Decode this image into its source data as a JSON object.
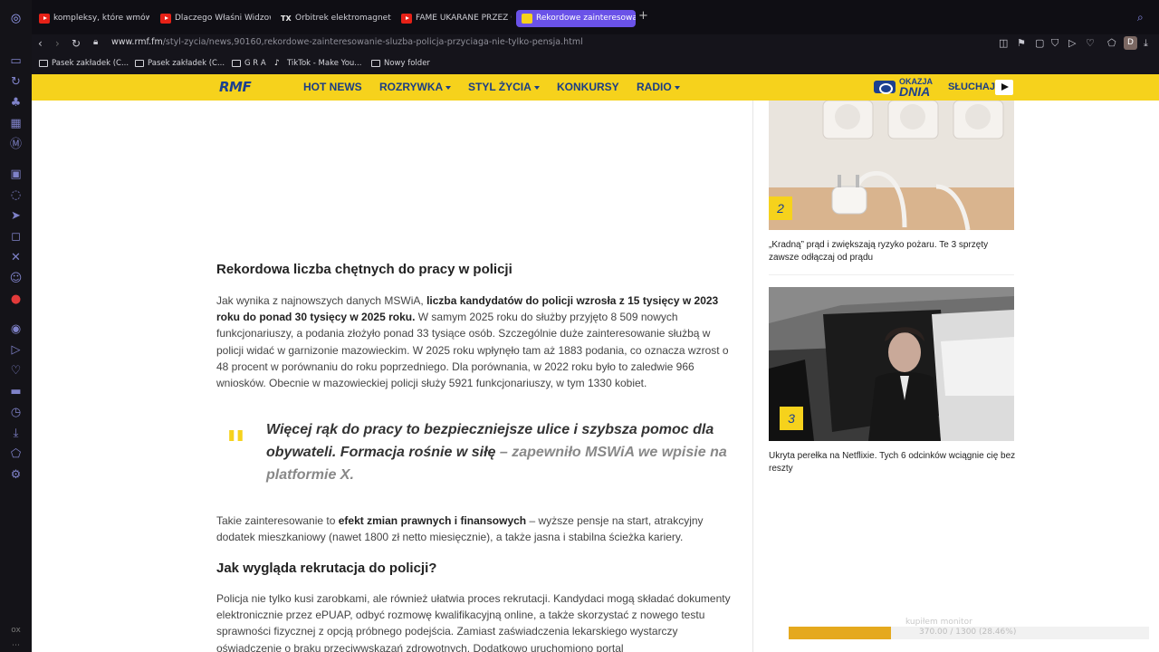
{
  "browser": {
    "tabs": [
      {
        "label": "kompleksy, które wmówiły",
        "favicon": "youtube-icon"
      },
      {
        "label": "Dlaczego Właśni Widzowie",
        "favicon": "youtube-icon"
      },
      {
        "label": "Orbitrek elektromagnetyczny",
        "favicon": "tx-icon"
      },
      {
        "label": "FAME UKARANE PRZEZ O",
        "favicon": "youtube-icon"
      },
      {
        "label": "Rekordowe zainteresowanie",
        "favicon": "rmf-icon",
        "active": true
      }
    ],
    "new_tab": "+",
    "url_host": "www.rmf.fm",
    "url_path": "/styl-zycia/news,90160,rekordowe-zainteresowanie-sluzba-policja-przyciaga-nie-tylko-pensja.html",
    "profile_initial": "D",
    "bookmarks": [
      {
        "label": "Pasek zakładek (C...",
        "icon": "folder-icon"
      },
      {
        "label": "Pasek zakładek (C...",
        "icon": "folder-icon"
      },
      {
        "label": "G R A",
        "icon": "folder-icon"
      },
      {
        "label": "TikTok - Make You...",
        "icon": "tiktok-icon"
      },
      {
        "label": "Nowy folder",
        "icon": "folder-icon"
      }
    ],
    "sidebar_bottom": "ox"
  },
  "site": {
    "logo": "RMF",
    "menu": [
      {
        "label": "HOT NEWS",
        "dropdown": false
      },
      {
        "label": "ROZRYWKA",
        "dropdown": true
      },
      {
        "label": "STYL ŻYCIA",
        "dropdown": true
      },
      {
        "label": "KONKURSY",
        "dropdown": false
      },
      {
        "label": "RADIO",
        "dropdown": true
      }
    ],
    "okazja_top": "OKAZJA",
    "okazja_bottom": "DNIA",
    "listen": "SŁUCHAJ",
    "accent": "#f6d21c",
    "brand_blue": "#1b3f8f"
  },
  "article": {
    "heading1": "Rekordowa liczba chętnych do pracy w policji",
    "p1_a": "Jak wynika z najnowszych danych MSWiA, ",
    "p1_bold": "liczba kandydatów do policji wzrosła z 15 tysięcy w 2023 roku do ponad 30 tysięcy w 2025 roku.",
    "p1_b": " W samym 2025 roku do służby przyjęto 8 509 nowych funkcjonariuszy, a podania złożyło ponad 33 tysiące osób. Szczególnie duże zainteresowanie służbą w policji widać w garnizonie mazowieckim. W 2025 roku wpłynęło tam aż 1883 podania, co oznacza wzrost o 48 procent w porównaniu do roku poprzedniego. Dla porównania, w 2022 roku było to zaledwie 966 wniosków. Obecnie w mazowieckiej policji służy 5921 funkcjonariuszy, w tym 1330 kobiet.",
    "quote_mark": "\"",
    "quote_text": "Więcej rąk do pracy to bezpieczniejsze ulice i szybsza pomoc dla obywateli. Formacja rośnie w siłę",
    "quote_source": " – zapewniło MSWiA we wpisie na platformie X.",
    "p2_a": "Takie zainteresowanie to ",
    "p2_bold": "efekt zmian prawnych i finansowych",
    "p2_b": " – wyższe pensje na start, atrakcyjny dodatek mieszkaniowy (nawet 1800 zł netto miesięcznie), a także jasna i stabilna ścieżka kariery.",
    "heading2": "Jak wygląda rekrutacja do policji?",
    "p3": "Policja nie tylko kusi zarobkami, ale również ułatwia proces rekrutacji. Kandydaci mogą składać dokumenty elektronicznie przez ePUAP, odbyć rozmowę kwalifikacyjną online, a także skorzystać z nowego testu sprawności fizycznej z opcją próbnego podejścia. Zamiast zaświadczenia lekarskiego wystarczy oświadczenie o braku przeciwwskazań zdrowotnych. Dodatkowo uruchomiono portal"
  },
  "sidebar_cards": [
    {
      "number": "2",
      "title": "„Kradną” prąd i zwiększają ryzyko pożaru. Te 3 sprzęty zawsze odłączaj od prądu"
    },
    {
      "number": "3",
      "title": "Ukryta perełka na Netflixie. Tych 6 odcinków wciągnie cię bez reszty"
    }
  ],
  "overlay": {
    "label": "kupiłem monitor",
    "progress_text": "370.00 / 1300 (28.46%)",
    "progress_fraction": 0.2846,
    "color": "#e5a91e"
  }
}
